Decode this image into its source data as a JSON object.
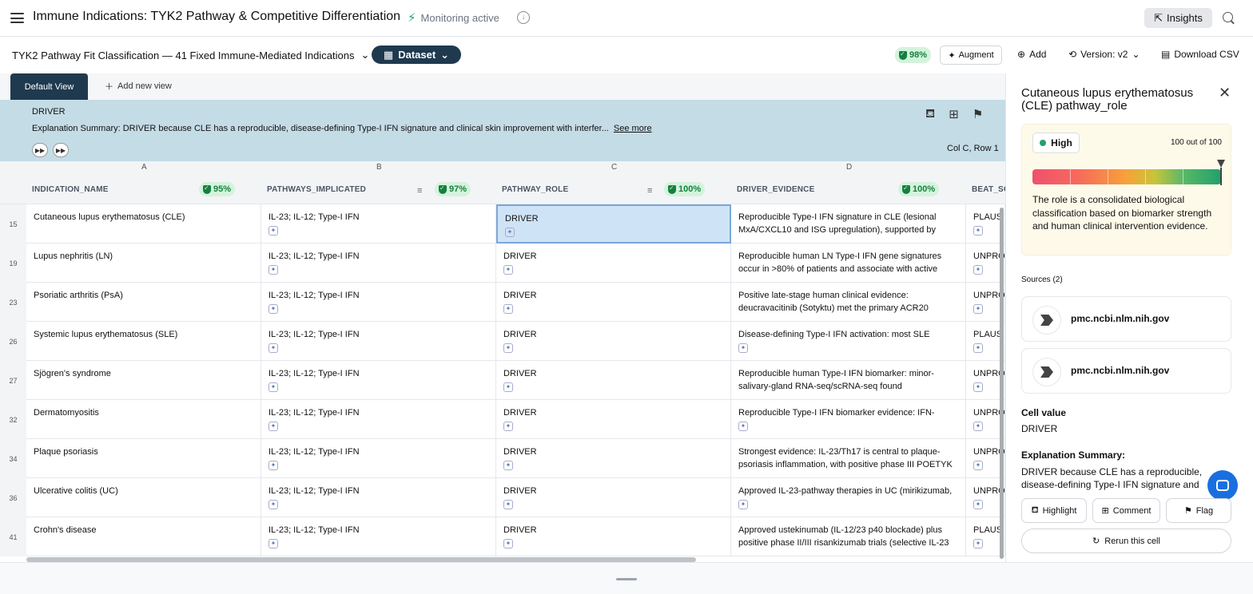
{
  "header": {
    "title": "Immune Indications: TYK2 Pathway & Competitive Differentiation",
    "monitoring": "Monitoring active",
    "insights_label": "Insights"
  },
  "toolbar": {
    "dataset_title": "TYK2 Pathway Fit Classification — 41 Fixed Immune-Mediated Indications",
    "dataset_button": "Dataset",
    "quality_pct": "98%",
    "augment": "Augment",
    "add": "Add",
    "version": "Version: v2",
    "download": "Download CSV"
  },
  "tabs": {
    "default": "Default View",
    "add_new": "Add new view"
  },
  "banner": {
    "label": "DRIVER",
    "summary": "Explanation Summary: DRIVER because CLE has a reproducible, disease-defining Type-I IFN signature and clinical skin improvement with interfer...",
    "see_more": "See more",
    "position": "Col C, Row 1"
  },
  "grid": {
    "letters": [
      "A",
      "B",
      "C",
      "D"
    ],
    "columns": [
      {
        "name": "INDICATION_NAME",
        "pct": "95%"
      },
      {
        "name": "PATHWAYS_IMPLICATED",
        "pct": "97%"
      },
      {
        "name": "PATHWAY_ROLE",
        "pct": "100%"
      },
      {
        "name": "DRIVER_EVIDENCE",
        "pct": "100%"
      },
      {
        "name": "BEAT_SO"
      }
    ],
    "rows": [
      {
        "n": "15",
        "a": "Cutaneous lupus erythematosus (CLE)",
        "b": "IL-23; IL-12; Type-I IFN",
        "c": "DRIVER",
        "d": "Reproducible Type-I IFN signature in CLE (lesional MxA/CXCL10 and ISG upregulation), supported by",
        "e": "PLAUS"
      },
      {
        "n": "19",
        "a": "Lupus nephritis (LN)",
        "b": "IL-23; IL-12; Type-I IFN",
        "c": "DRIVER",
        "d": "Reproducible human LN Type-I IFN gene signatures occur in >80% of patients and associate with active",
        "e": "UNPRO"
      },
      {
        "n": "23",
        "a": "Psoriatic arthritis (PsA)",
        "b": "IL-23; IL-12; Type-I IFN",
        "c": "DRIVER",
        "d": "Positive late-stage human clinical evidence: deucravacitinib (Sotyktu) met the primary ACR20",
        "e": "UNPRO"
      },
      {
        "n": "26",
        "a": "Systemic lupus erythematosus (SLE)",
        "b": "IL-23; IL-12; Type-I IFN",
        "c": "DRIVER",
        "d": "Disease-defining Type-I IFN activation: most SLE",
        "e": "PLAUS"
      },
      {
        "n": "27",
        "a": "Sjögren's syndrome",
        "b": "IL-23; IL-12; Type-I IFN",
        "c": "DRIVER",
        "d": "Reproducible human Type-I IFN biomarker: minor-salivary-gland RNA-seq/scRNA-seq found",
        "e": "UNPRO"
      },
      {
        "n": "32",
        "a": "Dermatomyositis",
        "b": "IL-23; IL-12; Type-I IFN",
        "c": "DRIVER",
        "d": "Reproducible Type-I IFN biomarker evidence: IFN-",
        "e": "UNPRO"
      },
      {
        "n": "34",
        "a": "Plaque psoriasis",
        "b": "IL-23; IL-12; Type-I IFN",
        "c": "DRIVER",
        "d": "Strongest evidence: IL-23/Th17 is central to plaque-psoriasis inflammation, with positive phase III POETYK",
        "e": "UNPRO"
      },
      {
        "n": "36",
        "a": "Ulcerative colitis (UC)",
        "b": "IL-23; IL-12; Type-I IFN",
        "c": "DRIVER",
        "d": "Approved IL-23-pathway therapies in UC (mirikizumab,",
        "e": "UNPRO"
      },
      {
        "n": "41",
        "a": "Crohn's disease",
        "b": "IL-23; IL-12; Type-I IFN",
        "c": "DRIVER",
        "d": "Approved ustekinumab (IL-12/23 p40 blockade) plus positive phase II/III risankizumab trials (selective IL-23",
        "e": "PLAUS"
      }
    ]
  },
  "panel": {
    "title": "Cutaneous lupus erythematosus (CLE) pathway_role",
    "confidence": "High",
    "score_text": "100 out of 100",
    "score_fraction": 1.0,
    "description": "The role is a consolidated biological classification based on biomarker strength and human clinical intervention evidence.",
    "sources_label": "Sources (2)",
    "sources": [
      "pmc.ncbi.nlm.nih.gov",
      "pmc.ncbi.nlm.nih.gov"
    ],
    "cell_value_label": "Cell value",
    "cell_value": "DRIVER",
    "explanation_label": "Explanation Summary:",
    "explanation": "DRIVER because CLE has a reproducible, disease-defining Type-I IFN signature and clinical skin improvement with interferon-targeted therapy.",
    "highlight": "Highlight",
    "comment": "Comment",
    "flag": "Flag",
    "rerun": "Rerun this cell"
  },
  "colors": {
    "accent_dark": "#1f3a4f",
    "banner_bg": "#c4dce6",
    "success": "#15803d",
    "selected_cell": "#cfe3f7"
  }
}
